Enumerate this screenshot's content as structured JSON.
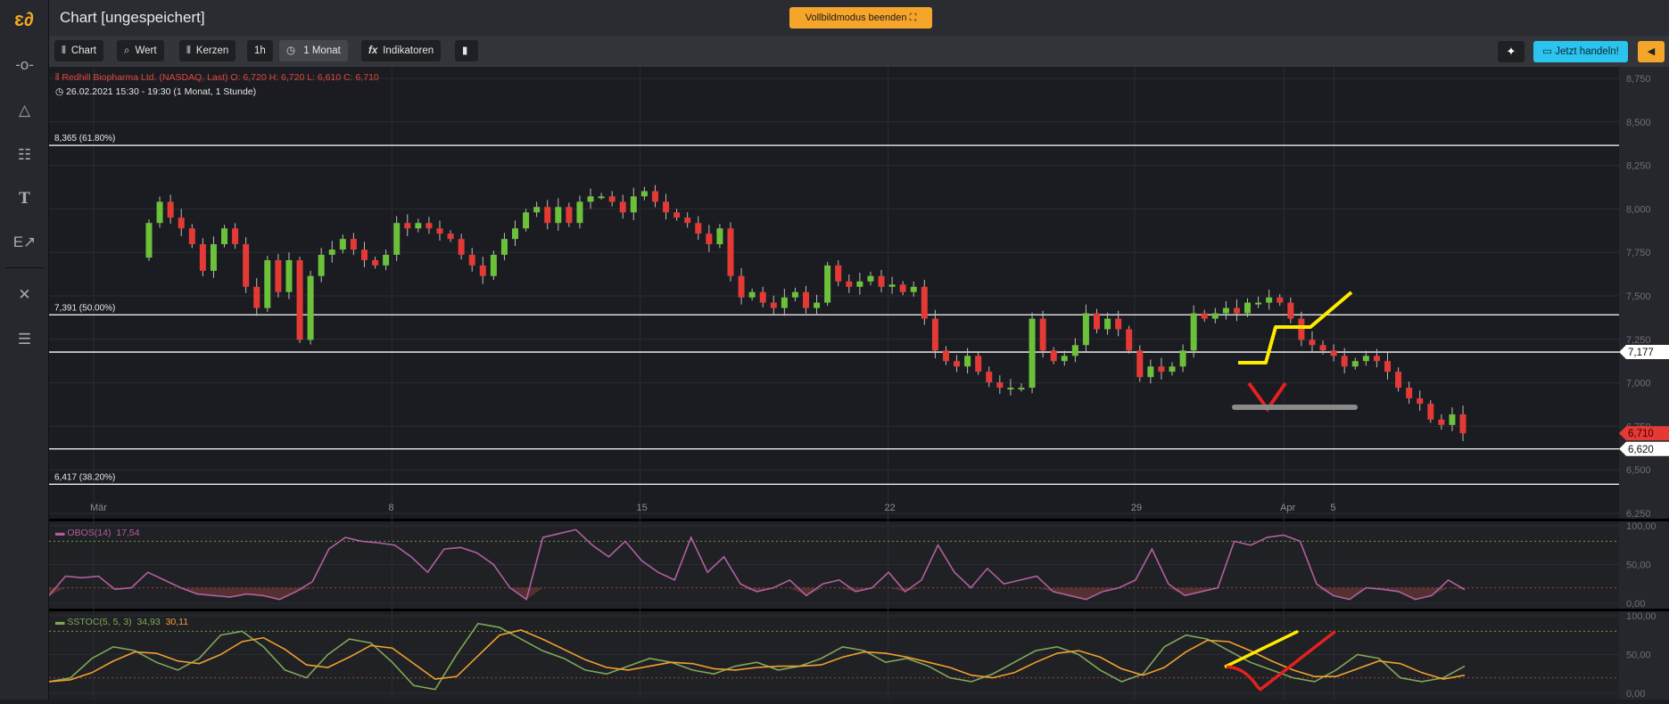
{
  "app": {
    "title": "Chart [ungespeichert]",
    "fullscreen_button": "Vollbildmodus beenden"
  },
  "sidebar": {
    "items": [
      "horizontal-line-tool",
      "triangle-tool",
      "fibonacci-tool",
      "text-tool",
      "annotate-arrow-tool",
      "tools-settings",
      "layout-template"
    ]
  },
  "toolbar": {
    "chart": "Chart",
    "wert": "Wert",
    "kerzen": "Kerzen",
    "interval": "1h",
    "range": "1 Monat",
    "indikatoren": "Indikatoren",
    "trade": "Jetzt handeln!"
  },
  "instrument": {
    "line1": "Redhill Biopharma Ltd. (NASDAQ, Last)  O: 6,720  H: 6,720  L: 6,610  C: 6,710",
    "line2": "26.02.2021 15:30 - 19:30   (1 Monat, 1 Stunde)"
  },
  "colors": {
    "up": "#6cc13a",
    "down": "#e53935",
    "accent": "#f6a52b",
    "trade": "#2bc4ef",
    "obos": "#b0609f",
    "sstoc_k": "#7fa858",
    "sstoc_d": "#f0a030"
  },
  "chart_data": [
    {
      "type": "candlestick",
      "title": "Redhill Biopharma Ltd. (NASDAQ, Last)",
      "ylim": [
        6.25,
        8.75
      ],
      "yticks": [
        "8,750",
        "8,500",
        "8,250",
        "8,000",
        "7,750",
        "7,500",
        "7,250",
        "7,000",
        "6,750",
        "6,500",
        "6,250"
      ],
      "xticks": [
        {
          "label": "Mär",
          "pos": 0.0
        },
        {
          "label": "8",
          "pos": 0.19
        },
        {
          "label": "15",
          "pos": 0.348
        },
        {
          "label": "22",
          "pos": 0.506
        },
        {
          "label": "29",
          "pos": 0.663
        },
        {
          "label": "Apr",
          "pos": 0.758
        },
        {
          "label": "5",
          "pos": 0.79
        }
      ],
      "first_open": 7.72,
      "closes": [
        7.919,
        8.041,
        7.95,
        7.888,
        7.797,
        7.644,
        7.797,
        7.888,
        7.797,
        7.552,
        7.43,
        7.705,
        7.522,
        7.705,
        7.247,
        7.614,
        7.736,
        7.766,
        7.827,
        7.766,
        7.705,
        7.675,
        7.736,
        7.919,
        7.888,
        7.919,
        7.888,
        7.858,
        7.827,
        7.736,
        7.675,
        7.614,
        7.736,
        7.827,
        7.888,
        7.98,
        8.011,
        7.919,
        8.011,
        7.919,
        8.041,
        8.072,
        8.072,
        8.041,
        7.98,
        8.072,
        8.102,
        8.041,
        7.98,
        7.95,
        7.919,
        7.858,
        7.797,
        7.888,
        7.614,
        7.491,
        7.522,
        7.461,
        7.43,
        7.491,
        7.522,
        7.43,
        7.461,
        7.675,
        7.583,
        7.552,
        7.583,
        7.614,
        7.552,
        7.565,
        7.522,
        7.552,
        7.369,
        7.186,
        7.125,
        7.094,
        7.155,
        7.064,
        7.003,
        6.972,
        6.972,
        6.972,
        7.369,
        7.186,
        7.125,
        7.155,
        7.217,
        7.4,
        7.308,
        7.369,
        7.308,
        7.186,
        7.033,
        7.094,
        7.064,
        7.094,
        7.186,
        7.4,
        7.369,
        7.4,
        7.43,
        7.4,
        7.461,
        7.461,
        7.491,
        7.461,
        7.369,
        7.247,
        7.217,
        7.186,
        7.155,
        7.094,
        7.125,
        7.155,
        7.125,
        7.064,
        6.972,
        6.911,
        6.88,
        6.789,
        6.758,
        6.819,
        6.71
      ],
      "levels": [
        {
          "value": 8.365,
          "label": "8,365 (61.80%)"
        },
        {
          "value": 7.391,
          "label": "7,391 (50.00%)"
        },
        {
          "value": 7.177,
          "label": ""
        },
        {
          "value": 6.62,
          "label": ""
        },
        {
          "value": 6.417,
          "label": "6,417 (38.20%)"
        }
      ],
      "price_tags": [
        {
          "value": 7.177,
          "label": "7,177",
          "style": "white"
        },
        {
          "value": 6.71,
          "label": "6,710",
          "style": "red"
        },
        {
          "value": 6.62,
          "label": "6,620",
          "style": "white"
        }
      ]
    },
    {
      "type": "line",
      "title": "OBOS(14)",
      "last": "17,54",
      "ylim": [
        0,
        100
      ],
      "yticks": [
        "100,00",
        "50,00",
        "0,00"
      ],
      "bands": [
        20,
        80
      ],
      "values": [
        10,
        35,
        33,
        35,
        18,
        20,
        40,
        30,
        20,
        12,
        10,
        8,
        12,
        10,
        5,
        15,
        28,
        70,
        85,
        80,
        78,
        75,
        60,
        40,
        70,
        72,
        65,
        50,
        20,
        5,
        85,
        90,
        95,
        75,
        60,
        80,
        55,
        40,
        30,
        85,
        40,
        60,
        25,
        15,
        20,
        30,
        10,
        25,
        30,
        15,
        20,
        40,
        15,
        30,
        75,
        40,
        20,
        45,
        25,
        30,
        35,
        15,
        10,
        5,
        15,
        20,
        30,
        70,
        25,
        10,
        15,
        20,
        80,
        75,
        85,
        88,
        80,
        25,
        10,
        5,
        20,
        18,
        15,
        5,
        10,
        30,
        17.54
      ]
    },
    {
      "type": "line",
      "title": "SSTOC(5, 5, 3)",
      "last_k": "34,93",
      "last_d": "30,11",
      "ylim": [
        0,
        100
      ],
      "yticks": [
        "100,00",
        "50,00",
        "0,00"
      ],
      "bands": [
        20,
        80
      ],
      "k": [
        15,
        20,
        45,
        60,
        55,
        40,
        30,
        45,
        75,
        80,
        60,
        30,
        20,
        50,
        70,
        65,
        40,
        10,
        5,
        50,
        90,
        85,
        70,
        55,
        45,
        30,
        25,
        35,
        45,
        40,
        30,
        25,
        35,
        40,
        30,
        35,
        45,
        60,
        55,
        40,
        45,
        35,
        20,
        15,
        25,
        40,
        55,
        60,
        50,
        30,
        15,
        25,
        60,
        75,
        70,
        55,
        40,
        30,
        20,
        15,
        30,
        50,
        45,
        20,
        15,
        20,
        35
      ]
    }
  ]
}
